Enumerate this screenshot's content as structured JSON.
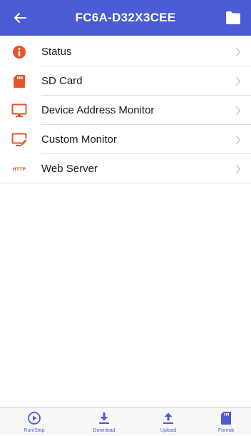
{
  "header": {
    "title": "FC6A-D32X3CEE",
    "back_icon": "arrow-left-icon",
    "folder_icon": "folder-icon",
    "color": "#4a5bd3"
  },
  "menu": {
    "items": [
      {
        "label": "Status",
        "icon": "info-icon"
      },
      {
        "label": "SD Card",
        "icon": "sd-card-icon"
      },
      {
        "label": "Device Address Monitor",
        "icon": "monitor-icon"
      },
      {
        "label": "Custom Monitor",
        "icon": "monitor-edit-icon"
      },
      {
        "label": "Web Server",
        "icon": "http-icon",
        "icon_text": "HTTP"
      }
    ],
    "icon_color": "#e8542a"
  },
  "tabbar": {
    "items": [
      {
        "label": "Run/Stop",
        "icon": "play-circle-icon"
      },
      {
        "label": "Download",
        "icon": "download-icon"
      },
      {
        "label": "Upload",
        "icon": "upload-icon"
      },
      {
        "label": "Format",
        "icon": "sd-card-icon"
      }
    ]
  }
}
